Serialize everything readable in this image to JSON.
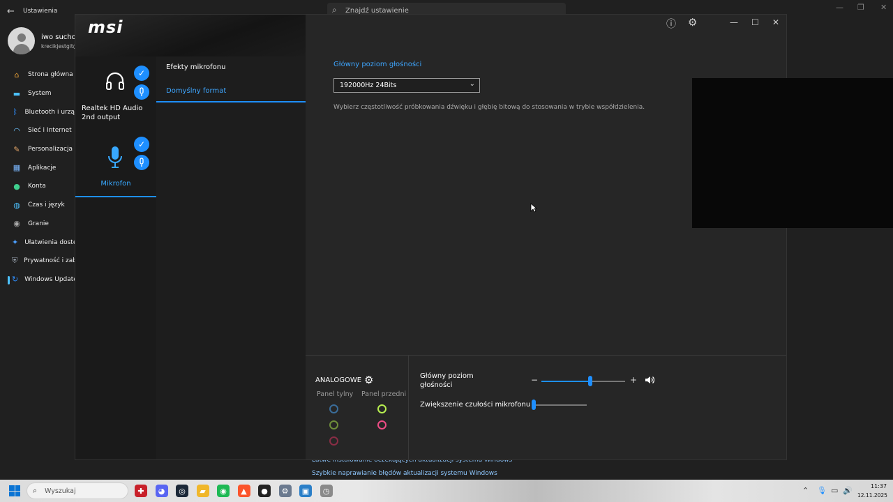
{
  "settings": {
    "window_title": "Ustawienia",
    "search_placeholder": "Znajdź ustawienie",
    "user_name": "iwo suchow",
    "user_email": "krecikjestgit@",
    "nav": [
      {
        "label": "Strona główna",
        "icon": "home-icon",
        "color": "#e8a038"
      },
      {
        "label": "System",
        "icon": "monitor-icon",
        "color": "#4cc2ff"
      },
      {
        "label": "Bluetooth i urzą",
        "icon": "bluetooth-icon",
        "color": "#2f8fff"
      },
      {
        "label": "Sieć i Internet",
        "icon": "wifi-icon",
        "color": "#6fc3ff"
      },
      {
        "label": "Personalizacja",
        "icon": "brush-icon",
        "color": "#e8a86a"
      },
      {
        "label": "Aplikacje",
        "icon": "apps-icon",
        "color": "#7ab7ff"
      },
      {
        "label": "Konta",
        "icon": "person-icon",
        "color": "#3fcf8e"
      },
      {
        "label": "Czas i język",
        "icon": "globe-icon",
        "color": "#4cc2ff"
      },
      {
        "label": "Granie",
        "icon": "gamepad-icon",
        "color": "#aaaaaa"
      },
      {
        "label": "Ułatwienia dostę",
        "icon": "accessibility-icon",
        "color": "#4c9fff"
      },
      {
        "label": "Prywatność i zab",
        "icon": "shield-icon",
        "color": "#9aa4b0"
      },
      {
        "label": "Windows Update",
        "icon": "update-icon",
        "color": "#2f8fff"
      }
    ],
    "active_nav_index": 11,
    "links": [
      "Łatwe instalowanie oczekujących aktualizacji systemu Windows",
      "Szybkie naprawianie błędów aktualizacji systemu Windows"
    ]
  },
  "msi": {
    "logo": "msi",
    "devices": [
      {
        "name": "Realtek HD Audio 2nd output",
        "icon": "headphones-icon"
      },
      {
        "name": "Mikrofon",
        "icon": "microphone-icon"
      }
    ],
    "tabs": [
      {
        "label": "Efekty mikrofonu"
      },
      {
        "label": "Domyślny format"
      }
    ],
    "active_tab_index": 1,
    "content": {
      "section_title": "Główny poziom głośności",
      "format_value": "192000Hz 24Bits",
      "description": "Wybierz częstotliwość próbkowania dźwięku i głębię bitową do stosowania w trybie współdzielenia."
    },
    "analog": {
      "title": "ANALOGOWE",
      "rear_label": "Panel tylny",
      "front_label": "Panel przedni",
      "rear_jacks": [
        "#3a6d9a",
        "#6f8f3a",
        "#8a2d45"
      ],
      "front_jacks": [
        "#b8f050",
        "#f04d86"
      ]
    },
    "volume": {
      "main_label": "Główny poziom głośności",
      "main_level": 0.58,
      "minus": "−",
      "plus": "+",
      "mic_boost_label": "Zwiększenie czułości mikrofonu",
      "mic_boost_level": 0.0
    }
  },
  "taskbar": {
    "search_placeholder": "Wyszukaj",
    "time": "11:37",
    "date": "12.11.2025",
    "apps": [
      {
        "name": "msi-center-icon",
        "color": "#c8202a"
      },
      {
        "name": "discord-icon",
        "color": "#5865f2"
      },
      {
        "name": "steam-icon",
        "color": "#1b2838"
      },
      {
        "name": "file-explorer-icon",
        "color": "#f0b72a"
      },
      {
        "name": "spotify-icon",
        "color": "#1db954"
      },
      {
        "name": "brave-icon",
        "color": "#fb542b"
      },
      {
        "name": "obs-icon",
        "color": "#222222"
      },
      {
        "name": "settings-icon",
        "color": "#6b7a8f"
      },
      {
        "name": "remote-desktop-icon",
        "color": "#2a7fc8"
      },
      {
        "name": "clock-app-icon",
        "color": "#8a8a8a"
      }
    ]
  }
}
